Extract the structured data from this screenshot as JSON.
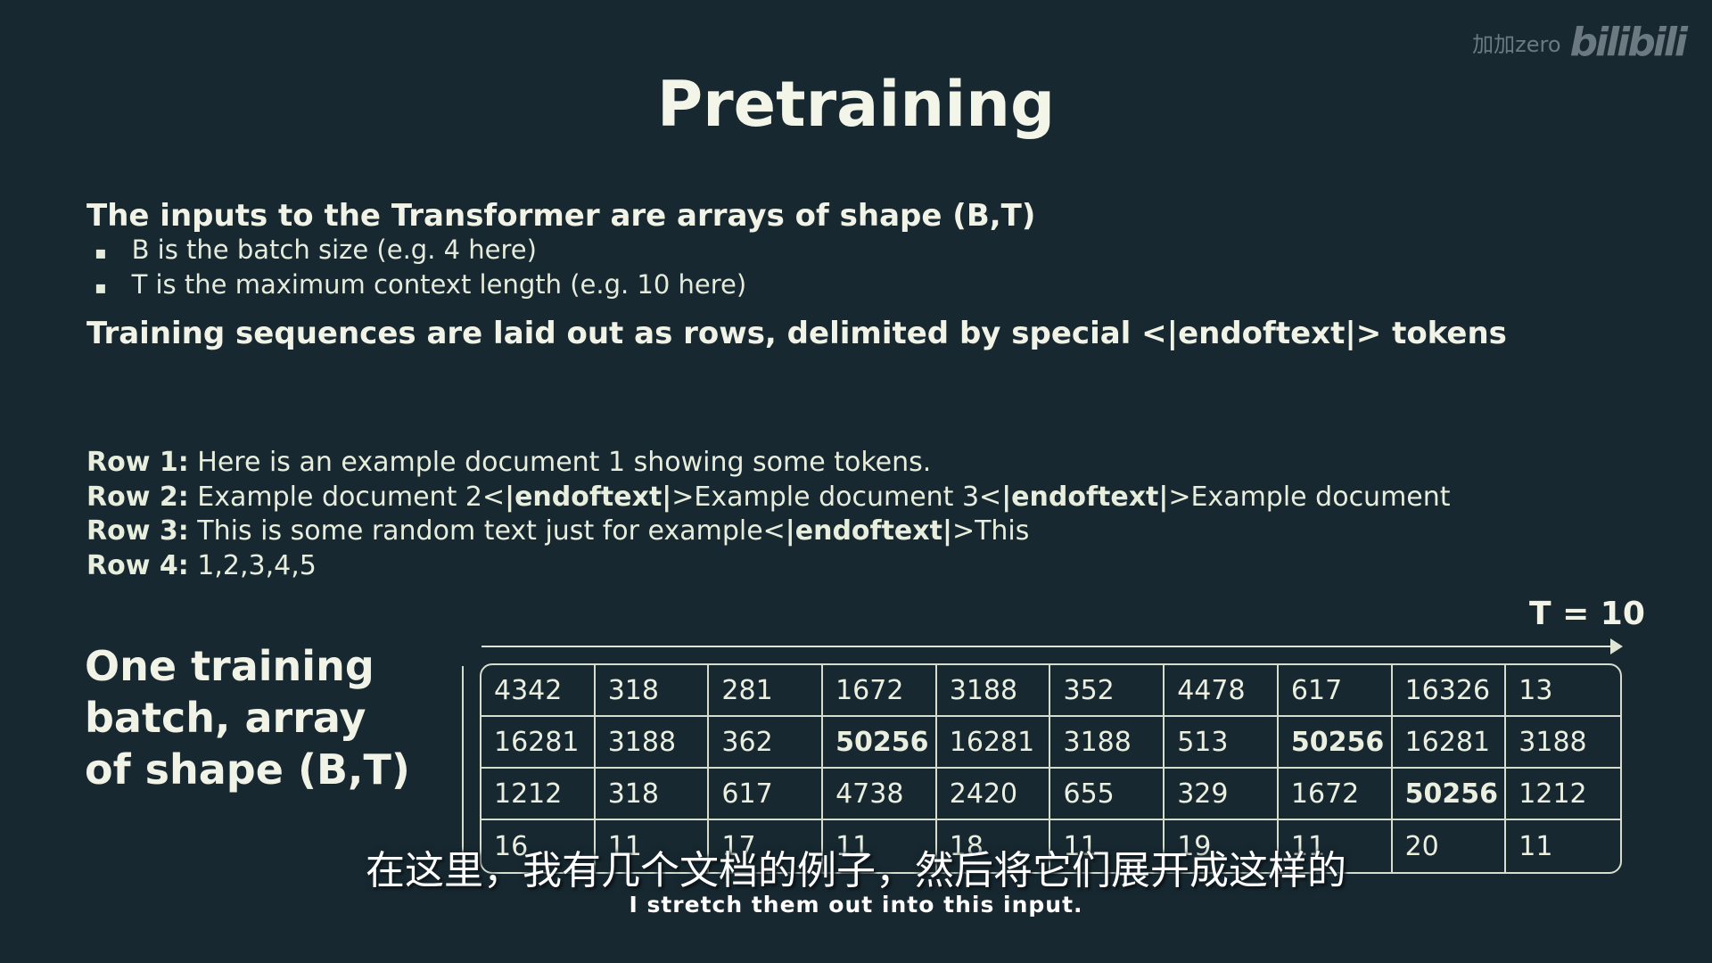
{
  "watermark": {
    "name": "加加zero",
    "logo": "bilibili"
  },
  "slide": {
    "title": "Pretraining",
    "heading1": "The inputs to the Transformer are arrays of shape (B,T)",
    "bullets": [
      "B is the batch size (e.g. 4 here)",
      "T is the maximum context length (e.g. 10 here)"
    ],
    "heading2": "Training sequences are laid out as rows, delimited by special <|endoftext|> tokens",
    "rows": [
      {
        "label": "Row 1:",
        "parts": [
          " Here is an example document 1 showing some tokens."
        ]
      },
      {
        "label": "Row 2:",
        "parts": [
          " Example document 2<",
          "|endoftext|",
          ">Example document 3<",
          "|endoftext|",
          ">Example document"
        ]
      },
      {
        "label": "Row 3:",
        "parts": [
          " This is some random text just for example<",
          "|endoftext|",
          ">This"
        ]
      },
      {
        "label": "Row 4:",
        "parts": [
          " 1,2,3,4,5"
        ]
      }
    ],
    "t_label": "T = 10",
    "batch_label_lines": [
      "One training",
      "batch, array",
      "of shape (B,T)"
    ],
    "grid": [
      [
        "4342",
        "318",
        "281",
        "1672",
        "3188",
        "352",
        "4478",
        "617",
        "16326",
        "13"
      ],
      [
        "16281",
        "3188",
        "362",
        "50256",
        "16281",
        "3188",
        "513",
        "50256",
        "16281",
        "3188"
      ],
      [
        "1212",
        "318",
        "617",
        "4738",
        "2420",
        "655",
        "329",
        "1672",
        "50256",
        "1212"
      ],
      [
        "16",
        "11",
        "17",
        "11",
        "18",
        "11",
        "19",
        "11",
        "20",
        "11"
      ]
    ],
    "special_token": "50256"
  },
  "subtitles": {
    "zh": "在这里，我有几个文档的例子，然后将它们展开成这样的",
    "en": "I stretch them out into this input."
  }
}
